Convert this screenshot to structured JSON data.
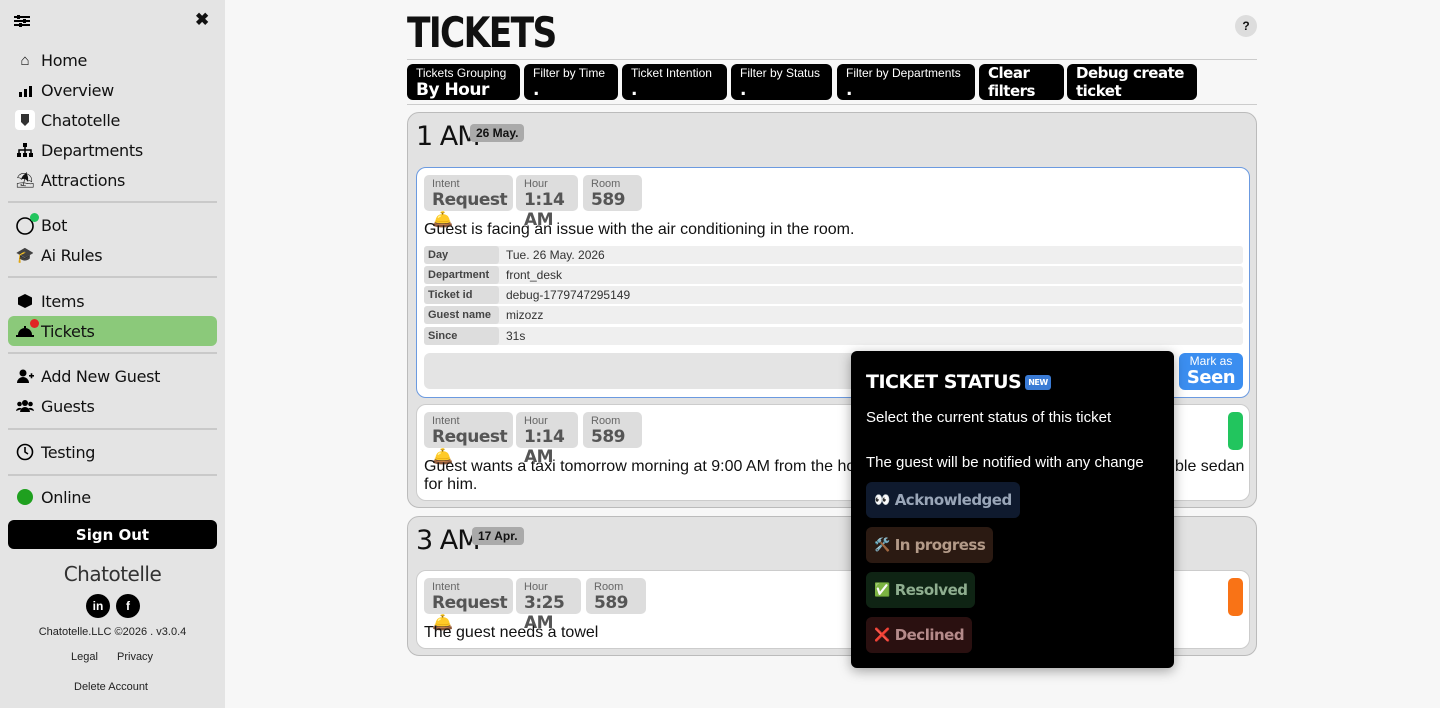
{
  "sidebar": {
    "items": [
      {
        "label": "Home",
        "icon": "home-icon"
      },
      {
        "label": "Overview",
        "icon": "chart-icon"
      },
      {
        "label": "Chatotelle",
        "icon": "hotel-logo-icon"
      },
      {
        "label": "Departments",
        "icon": "sitemap-icon"
      },
      {
        "label": "Attractions",
        "icon": "umbrella-beach-icon"
      },
      {
        "label": "Bot",
        "icon": "bot-icon"
      },
      {
        "label": "Ai Rules",
        "icon": "graduation-cap-icon"
      },
      {
        "label": "Items",
        "icon": "cubes-icon"
      },
      {
        "label": "Tickets",
        "icon": "bell-icon"
      },
      {
        "label": "Add New Guest",
        "icon": "user-plus-icon"
      },
      {
        "label": "Guests",
        "icon": "users-icon"
      },
      {
        "label": "Testing",
        "icon": "stopwatch-icon"
      },
      {
        "label": "Online",
        "icon": "status-dot"
      }
    ],
    "sign_out": "Sign Out",
    "brand": "Chatotelle",
    "copyright": "Chatotelle.LLC ©2026 . v3.0.4",
    "legal": "Legal",
    "privacy": "Privacy",
    "delete_account": "Delete Account"
  },
  "main": {
    "title": "TICKETS",
    "help": "?",
    "toolbar": {
      "grouping_label": "Tickets Grouping",
      "grouping_value": "By Hour",
      "time_label": "Filter by Time",
      "time_value": ".",
      "intention_label": "Ticket Intention",
      "intention_value": ".",
      "status_label": "Filter by Status",
      "status_value": ".",
      "departments_label": "Filter by Departments",
      "departments_value": ".",
      "clear": "Clear filters",
      "debug": "Debug create ticket"
    },
    "groups": [
      {
        "hour": "1 AM",
        "date": "26 May.",
        "tickets": [
          {
            "intent_label": "Intent",
            "intent": "Request 🛎️",
            "hour_label": "Hour",
            "hour": "1:14 AM",
            "room_label": "Room",
            "room": "589",
            "description": "Guest is facing an issue with the air conditioning in the room.",
            "details": [
              {
                "key": "Day",
                "value": "Tue. 26 May. 2026"
              },
              {
                "key": "Department",
                "value": "front_desk"
              },
              {
                "key": "Ticket id",
                "value": "debug-1779747295149"
              },
              {
                "key": "Guest name",
                "value": "mizozz"
              },
              {
                "key": "Since",
                "value": "31s"
              }
            ],
            "mark_small": "Mark as",
            "mark_big": "Seen"
          },
          {
            "intent_label": "Intent",
            "intent": "Request 🛎️",
            "hour_label": "Hour",
            "hour": "1:14 AM",
            "room_label": "Room",
            "room": "589",
            "description_left": "Guest wants a taxi tomorrow morning at 9:00 AM from the ho",
            "description_right": "ble sedan",
            "description_line2": "for him.",
            "status_color": "#22c55e"
          }
        ]
      },
      {
        "hour": "3 AM",
        "date": "17 Apr.",
        "tickets": [
          {
            "intent_label": "Intent",
            "intent": "Request 🛎️",
            "hour_label": "Hour",
            "hour": "3:25 AM",
            "room_label": "Room",
            "room": "589",
            "description": "The guest needs a towel",
            "status_color": "#f97316"
          }
        ]
      }
    ]
  },
  "popover": {
    "title": "TICKET STATUS",
    "new_badge": "NEW",
    "line1": "Select the current status of this ticket",
    "line2": "The guest will be notified with any change",
    "options": [
      {
        "emoji": "👀",
        "label": "Acknowledged",
        "bg": "#0f1a2e",
        "fg": "#9aa6b8"
      },
      {
        "emoji": "🛠️",
        "label": "In progress",
        "bg": "#2b1a12",
        "fg": "#b39a88"
      },
      {
        "emoji": "✅",
        "label": "Resolved",
        "bg": "#0f2414",
        "fg": "#8fae8f"
      },
      {
        "emoji": "❌",
        "label": "Declined",
        "bg": "#2a1010",
        "fg": "#b48a8a"
      }
    ]
  },
  "colors": {
    "accent_active": "#8bc97a",
    "primary_blue": "#3b8ef0",
    "online": "#1fa01f",
    "notify_red": "#e02424",
    "bot_green": "#22c55e"
  }
}
